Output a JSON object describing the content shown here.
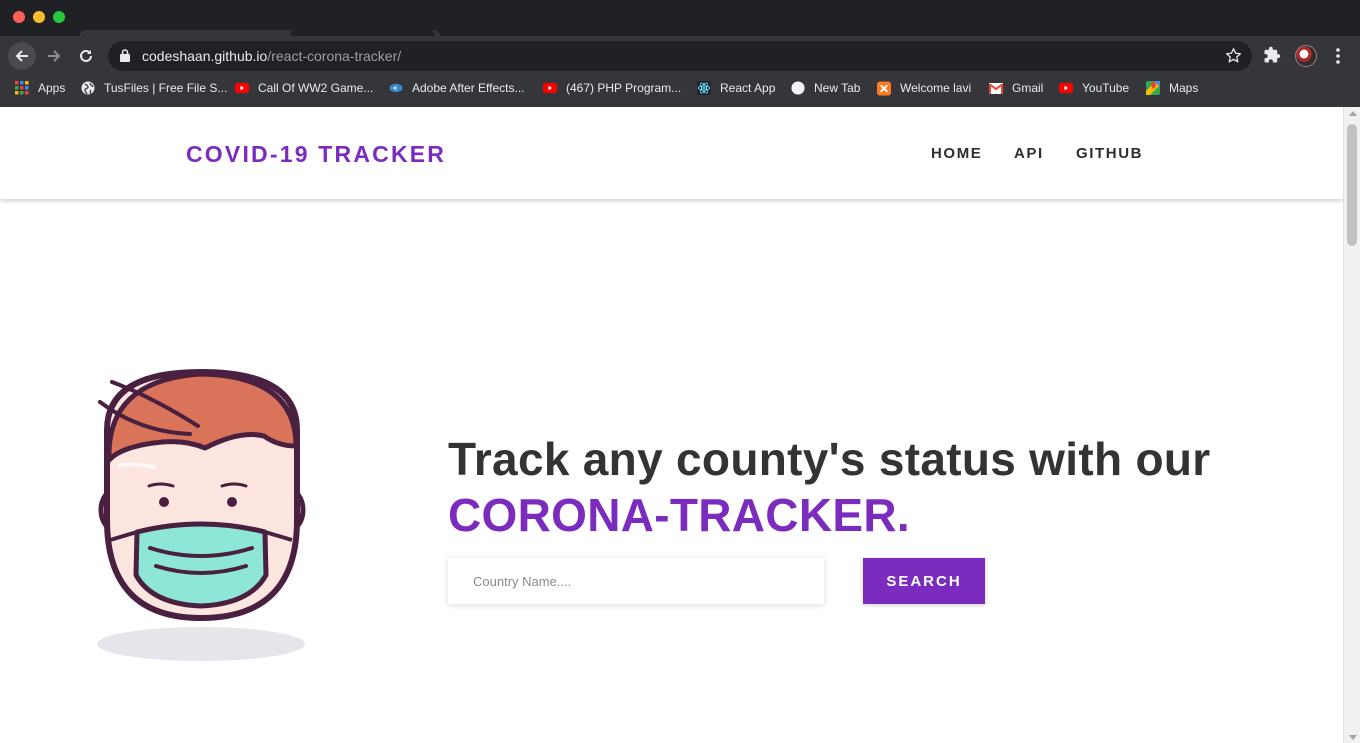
{
  "browser": {
    "url_host": "codeshaan.github.io",
    "url_path": "/react-corona-tracker/",
    "bookmarks": [
      {
        "label": "Apps",
        "icon": "apps-grid-icon"
      },
      {
        "label": "TusFiles | Free File S...",
        "icon": "globe-icon"
      },
      {
        "label": "Call Of WW2 Game...",
        "icon": "youtube-icon"
      },
      {
        "label": "Adobe After Effects...",
        "icon": "adobe-icon"
      },
      {
        "label": "(467) PHP Program...",
        "icon": "youtube-icon"
      },
      {
        "label": "React App",
        "icon": "react-icon"
      },
      {
        "label": "New Tab",
        "icon": "circle-icon"
      },
      {
        "label": "Welcome lavi",
        "icon": "xampp-icon"
      },
      {
        "label": "Gmail",
        "icon": "gmail-icon"
      },
      {
        "label": "YouTube",
        "icon": "youtube-icon"
      },
      {
        "label": "Maps",
        "icon": "maps-icon"
      }
    ]
  },
  "site": {
    "brand": "COVID-19 TRACKER",
    "nav": [
      "HOME",
      "API",
      "GITHUB"
    ]
  },
  "hero": {
    "title": "Track any county's status with our",
    "accent": "CORONA-TRACKER.",
    "search_placeholder": "Country Name....",
    "search_button": "SEARCH"
  },
  "colors": {
    "accent": "#7b2cbf",
    "heading": "#333333",
    "mask": "#8ee6d6",
    "hair": "#d9735a",
    "skin": "#fde6df"
  }
}
